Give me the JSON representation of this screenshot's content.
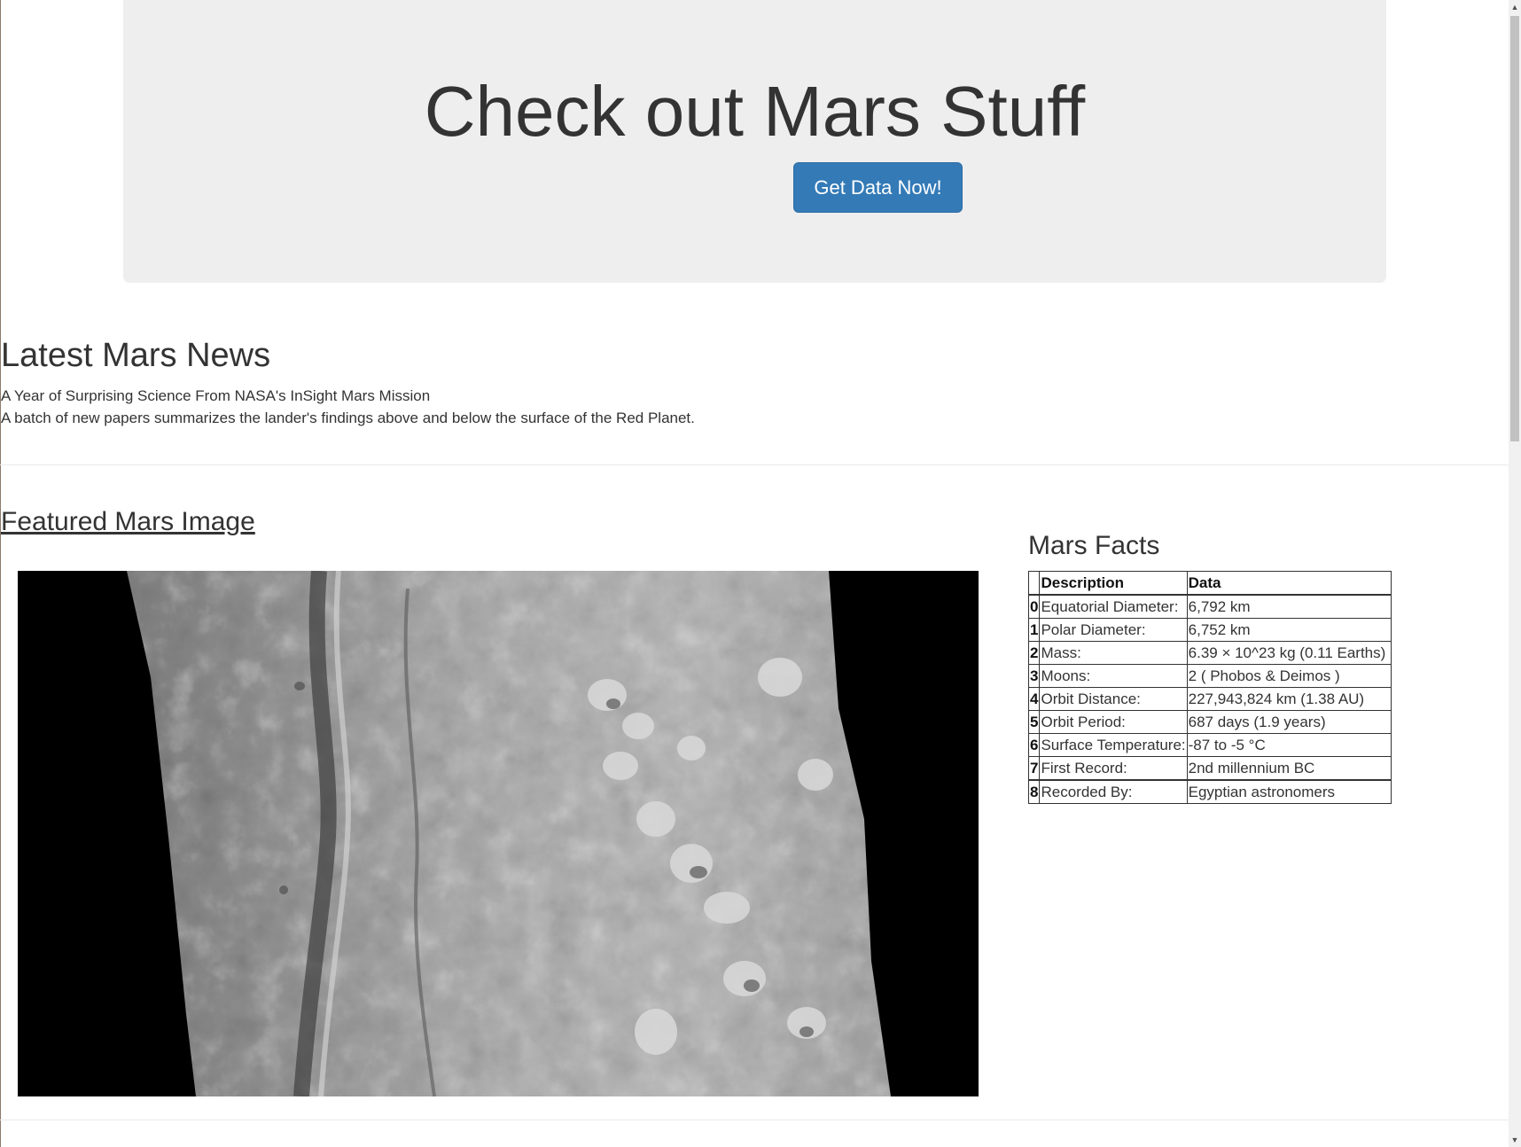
{
  "jumbotron": {
    "title": "Check out Mars Stuff",
    "button_label": "Get Data Now!"
  },
  "news": {
    "section_title": "Latest Mars News",
    "headline": "A Year of Surprising Science From NASA's InSight Mars Mission",
    "teaser": "A batch of new papers summarizes the lander's findings above and below the surface of the Red Planet."
  },
  "featured": {
    "link_label": "Featured Mars Image"
  },
  "facts": {
    "section_title": "Mars Facts",
    "headers": [
      "",
      "Description",
      "Data"
    ],
    "rows": [
      [
        "0",
        "Equatorial Diameter:",
        "6,792 km"
      ],
      [
        "1",
        "Polar Diameter:",
        "6,752 km"
      ],
      [
        "2",
        "Mass:",
        "6.39 × 10^23 kg (0.11 Earths)"
      ],
      [
        "3",
        "Moons:",
        "2 ( Phobos & Deimos )"
      ],
      [
        "4",
        "Orbit Distance:",
        "227,943,824 km (1.38 AU)"
      ],
      [
        "5",
        "Orbit Period:",
        "687 days (1.9 years)"
      ],
      [
        "6",
        "Surface Temperature:",
        "-87 to -5 °C"
      ],
      [
        "7",
        "First Record:",
        "2nd millennium BC"
      ],
      [
        "8",
        "Recorded By:",
        "Egyptian astronomers"
      ]
    ]
  },
  "scrollbar": {
    "up_icon": "triangle-up",
    "down_icon": "triangle-down"
  },
  "colors": {
    "jumbotron_bg": "#eeeeee",
    "button_bg": "#337ab7",
    "text": "#333333"
  }
}
